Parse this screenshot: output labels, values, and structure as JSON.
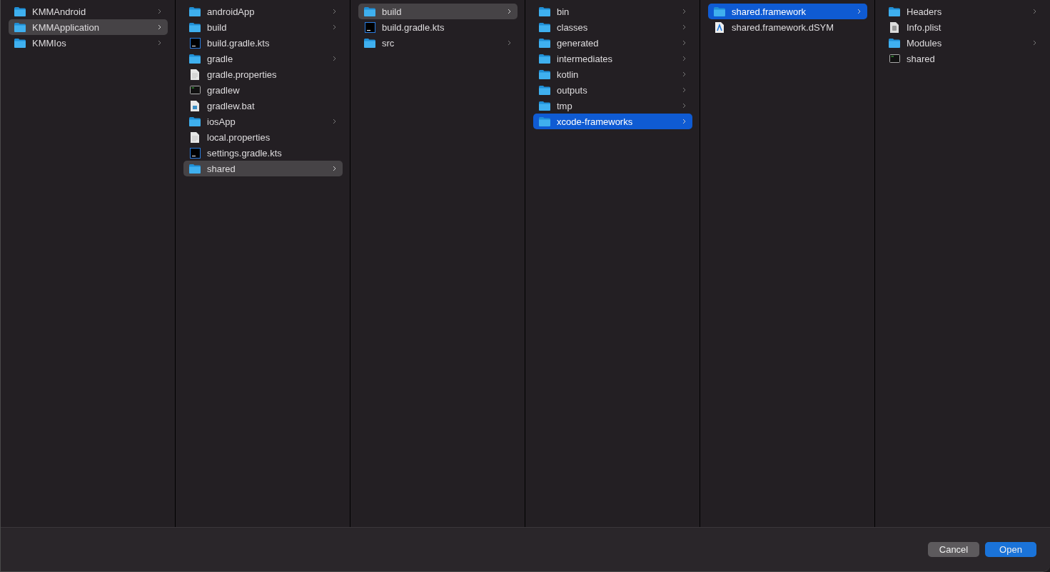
{
  "columns": [
    {
      "focused": false,
      "items": [
        {
          "name": "KMMAndroid",
          "kind": "folder",
          "expandable": true,
          "selected": false
        },
        {
          "name": "KMMApplication",
          "kind": "folder",
          "expandable": true,
          "selected": true
        },
        {
          "name": "KMMIos",
          "kind": "folder",
          "expandable": true,
          "selected": false
        }
      ]
    },
    {
      "focused": false,
      "items": [
        {
          "name": "androidApp",
          "kind": "folder",
          "expandable": true,
          "selected": false
        },
        {
          "name": "build",
          "kind": "folder",
          "expandable": true,
          "selected": false
        },
        {
          "name": "build.gradle.kts",
          "kind": "intellij",
          "expandable": false,
          "selected": false
        },
        {
          "name": "gradle",
          "kind": "folder",
          "expandable": true,
          "selected": false
        },
        {
          "name": "gradle.properties",
          "kind": "text",
          "expandable": false,
          "selected": false
        },
        {
          "name": "gradlew",
          "kind": "executable",
          "expandable": false,
          "selected": false
        },
        {
          "name": "gradlew.bat",
          "kind": "batch",
          "expandable": false,
          "selected": false
        },
        {
          "name": "iosApp",
          "kind": "folder",
          "expandable": true,
          "selected": false
        },
        {
          "name": "local.properties",
          "kind": "text",
          "expandable": false,
          "selected": false
        },
        {
          "name": "settings.gradle.kts",
          "kind": "intellij",
          "expandable": false,
          "selected": false
        },
        {
          "name": "shared",
          "kind": "folder",
          "expandable": true,
          "selected": true
        }
      ]
    },
    {
      "focused": false,
      "items": [
        {
          "name": "build",
          "kind": "folder",
          "expandable": true,
          "selected": true
        },
        {
          "name": "build.gradle.kts",
          "kind": "intellij",
          "expandable": false,
          "selected": false
        },
        {
          "name": "src",
          "kind": "folder",
          "expandable": true,
          "selected": false
        }
      ]
    },
    {
      "focused": true,
      "items": [
        {
          "name": "bin",
          "kind": "folder",
          "expandable": true,
          "selected": false
        },
        {
          "name": "classes",
          "kind": "folder",
          "expandable": true,
          "selected": false
        },
        {
          "name": "generated",
          "kind": "folder",
          "expandable": true,
          "selected": false
        },
        {
          "name": "intermediates",
          "kind": "folder",
          "expandable": true,
          "selected": false
        },
        {
          "name": "kotlin",
          "kind": "folder",
          "expandable": true,
          "selected": false
        },
        {
          "name": "outputs",
          "kind": "folder",
          "expandable": true,
          "selected": false
        },
        {
          "name": "tmp",
          "kind": "folder",
          "expandable": true,
          "selected": false
        },
        {
          "name": "xcode-frameworks",
          "kind": "folder",
          "expandable": true,
          "selected": true
        }
      ]
    },
    {
      "focused": true,
      "items": [
        {
          "name": "shared.framework",
          "kind": "folder",
          "expandable": true,
          "selected": true
        },
        {
          "name": "shared.framework.dSYM",
          "kind": "dsym",
          "expandable": false,
          "selected": false
        }
      ]
    },
    {
      "focused": false,
      "items": [
        {
          "name": "Headers",
          "kind": "folder",
          "expandable": true,
          "selected": false
        },
        {
          "name": "Info.plist",
          "kind": "plist",
          "expandable": false,
          "selected": false
        },
        {
          "name": "Modules",
          "kind": "folder",
          "expandable": true,
          "selected": false
        },
        {
          "name": "shared",
          "kind": "executable",
          "expandable": false,
          "selected": false
        }
      ]
    }
  ],
  "buttons": [
    {
      "label": "Cancel",
      "kind": "secondary"
    },
    {
      "label": "Open",
      "kind": "primary"
    }
  ]
}
